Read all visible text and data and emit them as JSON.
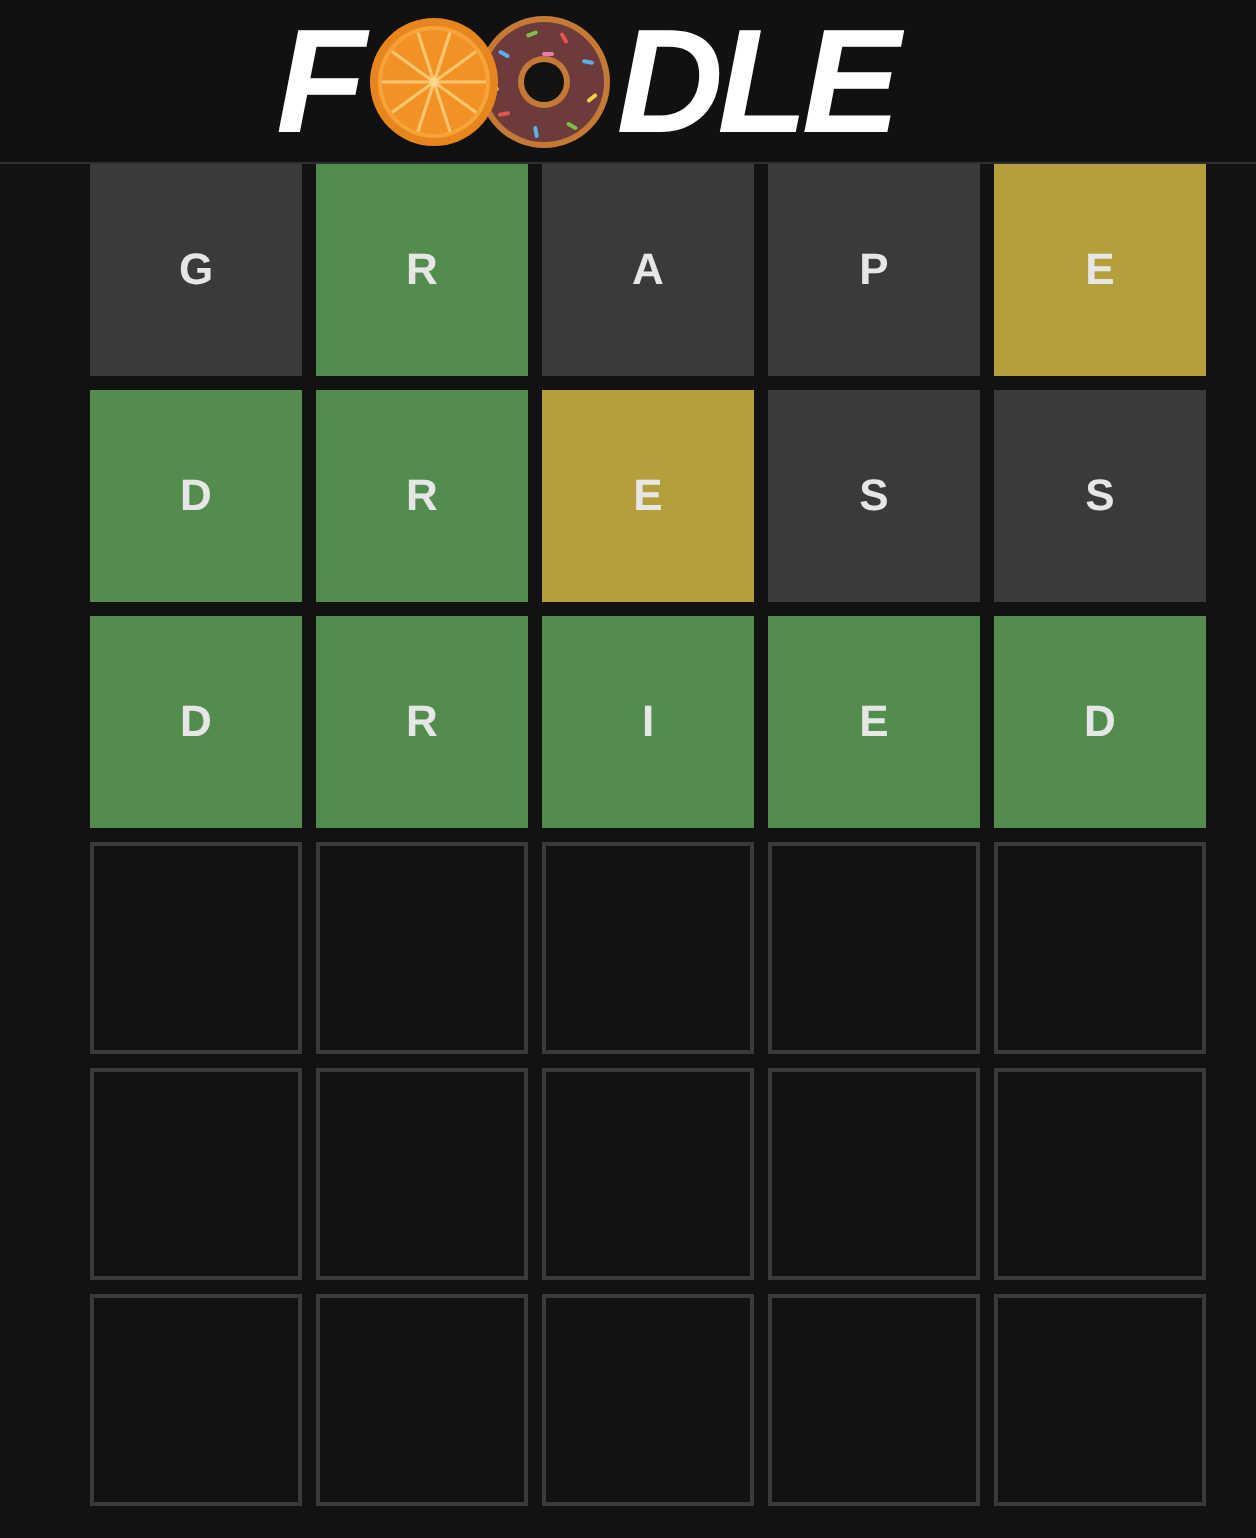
{
  "logo": {
    "lead": "F",
    "tail": "DLE"
  },
  "board": {
    "rows": [
      {
        "tiles": [
          {
            "kind": "letter",
            "letter": "G",
            "color": "#3a3a3c"
          },
          {
            "kind": "letter",
            "letter": "R",
            "color": "#538d4e"
          },
          {
            "kind": "letter",
            "letter": "A",
            "color": "#3a3a3c"
          },
          {
            "kind": "letter",
            "letter": "P",
            "color": "#3a3a3c"
          },
          {
            "kind": "letter",
            "letter": "E",
            "color": "#b59f3b"
          }
        ]
      },
      {
        "tiles": [
          {
            "kind": "letter",
            "letter": "D",
            "color": "#538d4e"
          },
          {
            "kind": "letter",
            "letter": "R",
            "color": "#538d4e"
          },
          {
            "kind": "letter",
            "letter": "E",
            "color": "#b59f3b"
          },
          {
            "kind": "letter",
            "letter": "S",
            "color": "#3a3a3c"
          },
          {
            "kind": "letter",
            "letter": "S",
            "color": "#3a3a3c"
          }
        ]
      },
      {
        "tiles": [
          {
            "kind": "letter",
            "letter": "D",
            "color": "#538d4e"
          },
          {
            "kind": "letter",
            "letter": "R",
            "color": "#538d4e"
          },
          {
            "kind": "letter",
            "letter": "I",
            "color": "#538d4e"
          },
          {
            "kind": "letter",
            "letter": "E",
            "color": "#538d4e"
          },
          {
            "kind": "letter",
            "letter": "D",
            "color": "#538d4e"
          }
        ]
      },
      {
        "tiles": [
          {
            "kind": "empty"
          },
          {
            "kind": "empty"
          },
          {
            "kind": "empty"
          },
          {
            "kind": "empty"
          },
          {
            "kind": "empty"
          }
        ]
      },
      {
        "tiles": [
          {
            "kind": "empty"
          },
          {
            "kind": "empty"
          },
          {
            "kind": "empty"
          },
          {
            "kind": "empty"
          },
          {
            "kind": "empty"
          }
        ]
      },
      {
        "tiles": [
          {
            "kind": "empty"
          },
          {
            "kind": "empty"
          },
          {
            "kind": "empty"
          },
          {
            "kind": "empty"
          },
          {
            "kind": "empty"
          }
        ]
      }
    ]
  }
}
